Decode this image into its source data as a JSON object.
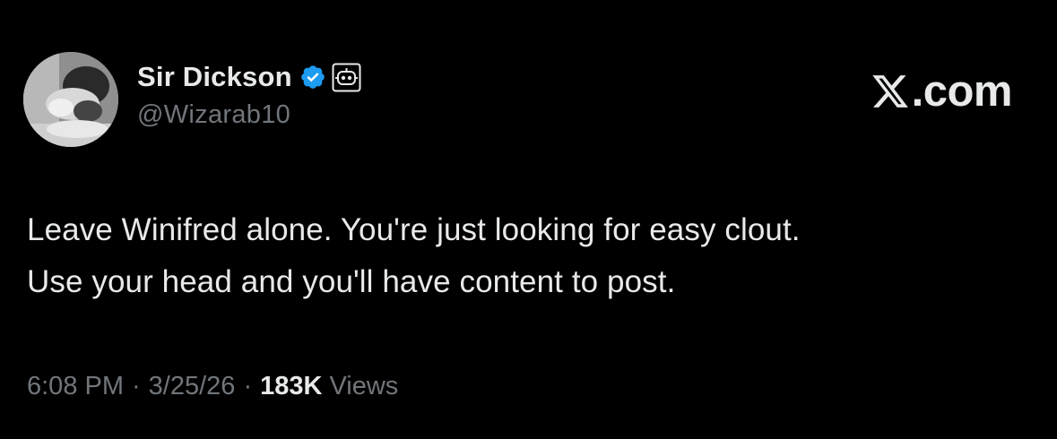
{
  "author": {
    "display_name": "Sir Dickson",
    "handle": "@Wizarab10",
    "verified_icon": "verified-badge-icon",
    "automated_icon": "bot-icon"
  },
  "watermark": {
    "logo_icon": "x-logo-icon",
    "text": ".com"
  },
  "tweet": {
    "lines": [
      "Leave Winifred alone. You're just looking for easy clout.",
      "Use your head and you'll have content to post."
    ]
  },
  "meta": {
    "time": "6:08 PM",
    "separator": "·",
    "date": "3/25/26",
    "views_count": "183K",
    "views_label": "Views"
  },
  "colors": {
    "background": "#000000",
    "primary_text": "#e7e9ea",
    "secondary_text": "#71767b",
    "verified_blue": "#1d9bf0"
  }
}
